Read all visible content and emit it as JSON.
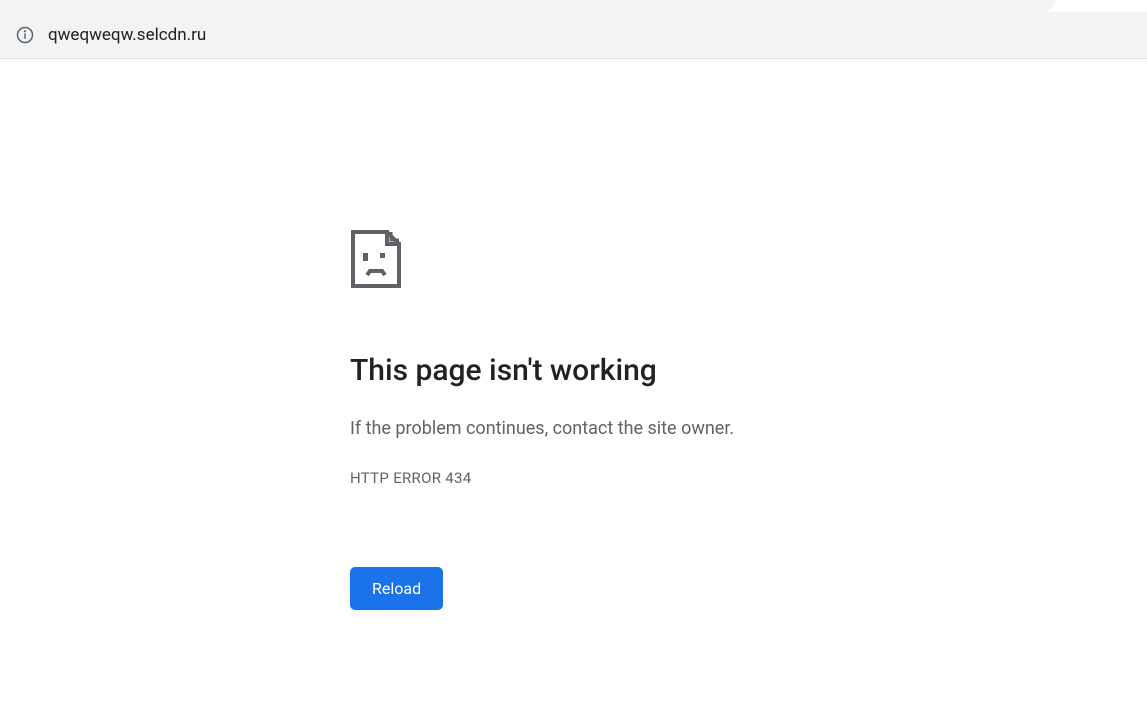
{
  "address_bar": {
    "url": "qweqweqw.selcdn.ru"
  },
  "error_page": {
    "heading": "This page isn't working",
    "message": "If the problem continues, contact the site owner.",
    "code": "HTTP ERROR 434",
    "reload_label": "Reload"
  }
}
